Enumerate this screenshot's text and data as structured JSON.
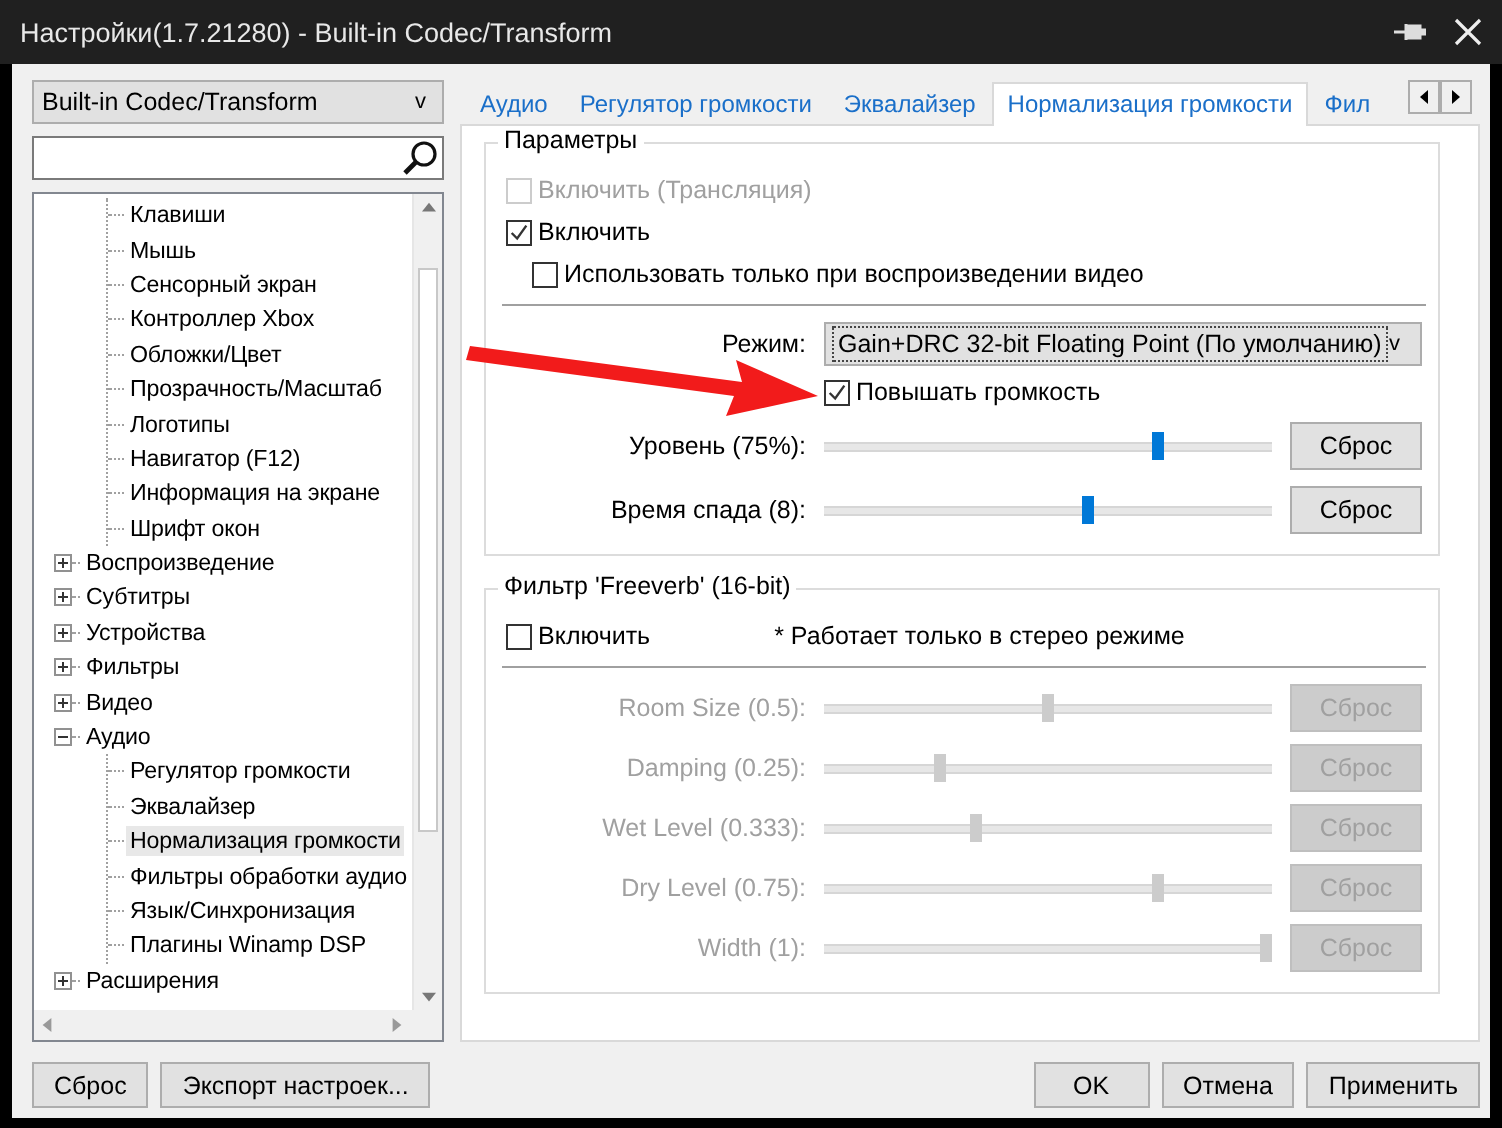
{
  "window": {
    "title": "Настройки(1.7.21280) - Built-in Codec/Transform"
  },
  "section_dropdown": {
    "value": "Built-in Codec/Transform",
    "caret": "v"
  },
  "tree": {
    "continued_children": [
      {
        "label": "Клавиши",
        "selected": false
      },
      {
        "label": "Мышь",
        "selected": false
      },
      {
        "label": "Сенсорный экран",
        "selected": false
      },
      {
        "label": "Контроллер Xbox",
        "selected": false
      },
      {
        "label": "Обложки/Цвет",
        "selected": false
      },
      {
        "label": "Прозрачность/Масштаб",
        "selected": false
      },
      {
        "label": "Логотипы",
        "selected": false
      },
      {
        "label": "Навигатор (F12)",
        "selected": false
      },
      {
        "label": "Информация на экране",
        "selected": false
      },
      {
        "label": "Шрифт окон",
        "selected": false
      }
    ],
    "nodes": [
      {
        "label": "Воспроизведение",
        "expanded": false,
        "selected": false
      },
      {
        "label": "Субтитры",
        "expanded": false,
        "selected": false
      },
      {
        "label": "Устройства",
        "expanded": false,
        "selected": false
      },
      {
        "label": "Фильтры",
        "expanded": false,
        "selected": false
      },
      {
        "label": "Видео",
        "expanded": false,
        "selected": false
      },
      {
        "label": "Аудио",
        "expanded": true,
        "selected": false,
        "children": [
          {
            "label": "Регулятор громкости",
            "selected": false
          },
          {
            "label": "Эквалайзер",
            "selected": false
          },
          {
            "label": "Нормализация громкости",
            "selected": true
          },
          {
            "label": "Фильтры обработки аудио",
            "selected": false
          },
          {
            "label": "Язык/Синхронизация",
            "selected": false
          },
          {
            "label": "Плагины Winamp DSP",
            "selected": false
          }
        ]
      },
      {
        "label": "Расширения",
        "expanded": false,
        "selected": false
      }
    ]
  },
  "tabs": [
    {
      "label": "Аудио",
      "selected": false
    },
    {
      "label": "Регулятор громкости",
      "selected": false
    },
    {
      "label": "Эквалайзер",
      "selected": false
    },
    {
      "label": "Нормализация громкости",
      "selected": true
    },
    {
      "label": "Фил",
      "selected": false
    }
  ],
  "params_group": {
    "title": "Параметры",
    "checkboxes": [
      {
        "label": "Включить (Трансляция)",
        "checked": false,
        "disabled": true
      },
      {
        "label": "Включить",
        "checked": true,
        "disabled": false,
        "children": [
          {
            "label": "Использовать только при воспроизведении видео",
            "checked": false,
            "disabled": false
          }
        ]
      }
    ],
    "mode": {
      "label": "Режим:",
      "value": "Gain+DRC 32-bit Floating Point (По умолчанию)",
      "caret": "v"
    },
    "boost": {
      "label": "Повышать громкость",
      "checked": true
    },
    "sliders": [
      {
        "label": "Уровень (75%):",
        "level": 0.75,
        "disabled": false,
        "button": "Сброс"
      },
      {
        "label": "Время спада (8):",
        "level": 0.59,
        "disabled": false,
        "button": "Сброс"
      }
    ]
  },
  "freeverb_group": {
    "title": "Фильтр 'Freeverb' (16-bit)",
    "enable": {
      "label": "Включить",
      "checked": false
    },
    "note": "* Работает только в стерео режиме",
    "sliders": [
      {
        "label": "Room Size (0.5):",
        "level": 0.5,
        "disabled": true,
        "button": "Сброс"
      },
      {
        "label": "Damping (0.25):",
        "level": 0.25,
        "disabled": true,
        "button": "Сброс"
      },
      {
        "label": "Wet Level (0.333):",
        "level": 0.333,
        "disabled": true,
        "button": "Сброс"
      },
      {
        "label": "Dry Level (0.75):",
        "level": 0.75,
        "disabled": true,
        "button": "Сброс"
      },
      {
        "label": "Width (1):",
        "level": 1,
        "disabled": true,
        "button": "Сброс"
      }
    ]
  },
  "footer": {
    "left_buttons": [
      "Сброс",
      "Экспорт настроек..."
    ],
    "right_buttons": [
      "OK",
      "Отмена",
      "Применить"
    ]
  }
}
